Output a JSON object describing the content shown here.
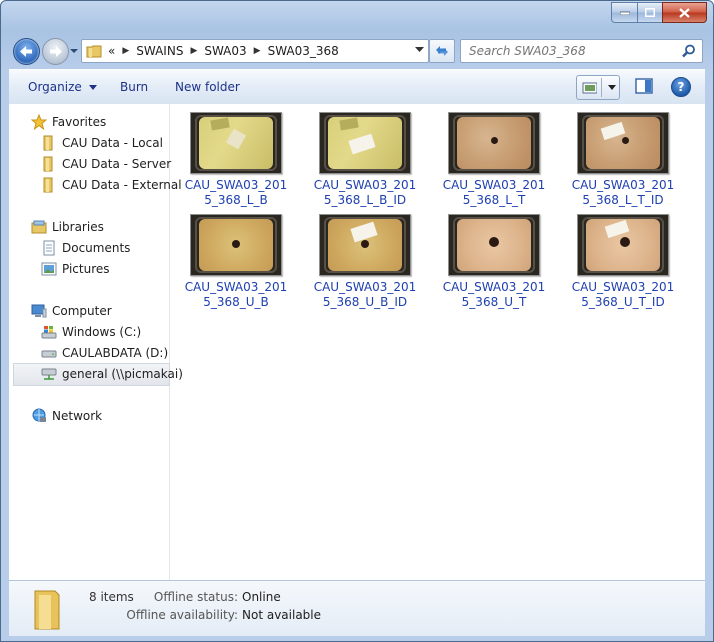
{
  "window": {
    "title_buttons": [
      "minimize",
      "maximize",
      "close"
    ]
  },
  "address": {
    "chevron": "«",
    "crumbs": [
      "SWAINS",
      "SWA03",
      "SWA03_368"
    ]
  },
  "search": {
    "placeholder": "Search SWA03_368"
  },
  "toolbar": {
    "organize": "Organize",
    "burn": "Burn",
    "new_folder": "New folder",
    "help": "?"
  },
  "nav": {
    "favorites": "Favorites",
    "fav_items": [
      "CAU Data - Local",
      "CAU Data - Server",
      "CAU Data - External"
    ],
    "libraries": "Libraries",
    "lib_items": [
      "Documents",
      "Pictures"
    ],
    "computer": "Computer",
    "drives": [
      "Windows (C:)",
      "CAULABDATA (D:)",
      "general (\\\\picmakai)"
    ],
    "network": "Network"
  },
  "files": [
    {
      "name": "CAU_SWA03_2015_368_L_B",
      "line1": "CAU_SWA03_201",
      "line2": "5_368_L_B"
    },
    {
      "name": "CAU_SWA03_2015_368_L_B_ID",
      "line1": "CAU_SWA03_201",
      "line2": "5_368_L_B_ID"
    },
    {
      "name": "CAU_SWA03_2015_368_L_T",
      "line1": "CAU_SWA03_201",
      "line2": "5_368_L_T"
    },
    {
      "name": "CAU_SWA03_2015_368_L_T_ID",
      "line1": "CAU_SWA03_201",
      "line2": "5_368_L_T_ID"
    },
    {
      "name": "CAU_SWA03_2015_368_U_B",
      "line1": "CAU_SWA03_201",
      "line2": "5_368_U_B"
    },
    {
      "name": "CAU_SWA03_2015_368_U_B_ID",
      "line1": "CAU_SWA03_201",
      "line2": "5_368_U_B_ID"
    },
    {
      "name": "CAU_SWA03_2015_368_U_T",
      "line1": "CAU_SWA03_201",
      "line2": "5_368_U_T"
    },
    {
      "name": "CAU_SWA03_2015_368_U_T_ID",
      "line1": "CAU_SWA03_201",
      "line2": "5_368_U_T_ID"
    }
  ],
  "details": {
    "count": "8 items",
    "offline_status_label": "Offline status:",
    "offline_status_value": "Online",
    "offline_avail_label": "Offline availability:",
    "offline_avail_value": "Not available"
  },
  "colors": {
    "link": "#1e3fb0",
    "chrome": "#b8cdea",
    "close": "#c8472e"
  }
}
